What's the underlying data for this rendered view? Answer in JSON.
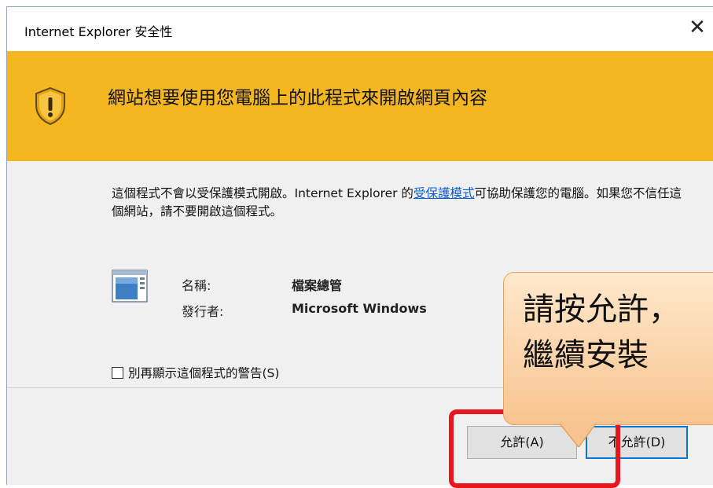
{
  "dialog": {
    "title": "Internet Explorer 安全性",
    "close_glyph": "✕",
    "banner": {
      "icon": "shield-warning-icon",
      "heading": "網站想要使用您電腦上的此程式來開啟網頁內容"
    },
    "description": {
      "part1": "這個程式不會以受保護模式開啟。Internet Explorer 的",
      "link": "受保護模式",
      "part2": "可協助保護您的電腦。如果您不信任這個網站，請不要開啟這個程式。"
    },
    "program": {
      "icon": "application-window-icon",
      "name_label": "名稱:",
      "name_value": "檔案總管",
      "publisher_label": "發行者:",
      "publisher_value": "Microsoft Windows"
    },
    "checkbox": {
      "label": "別再顯示這個程式的警告(S)",
      "checked": false
    },
    "buttons": {
      "allow": "允許(A)",
      "deny": "不允許(D)"
    }
  },
  "callout": {
    "text": "請按允許，\n繼續安裝"
  },
  "colors": {
    "banner": "#f4b722",
    "highlight": "#e8161f",
    "callout": "#f9cfa0",
    "link": "#0b5bd3"
  }
}
